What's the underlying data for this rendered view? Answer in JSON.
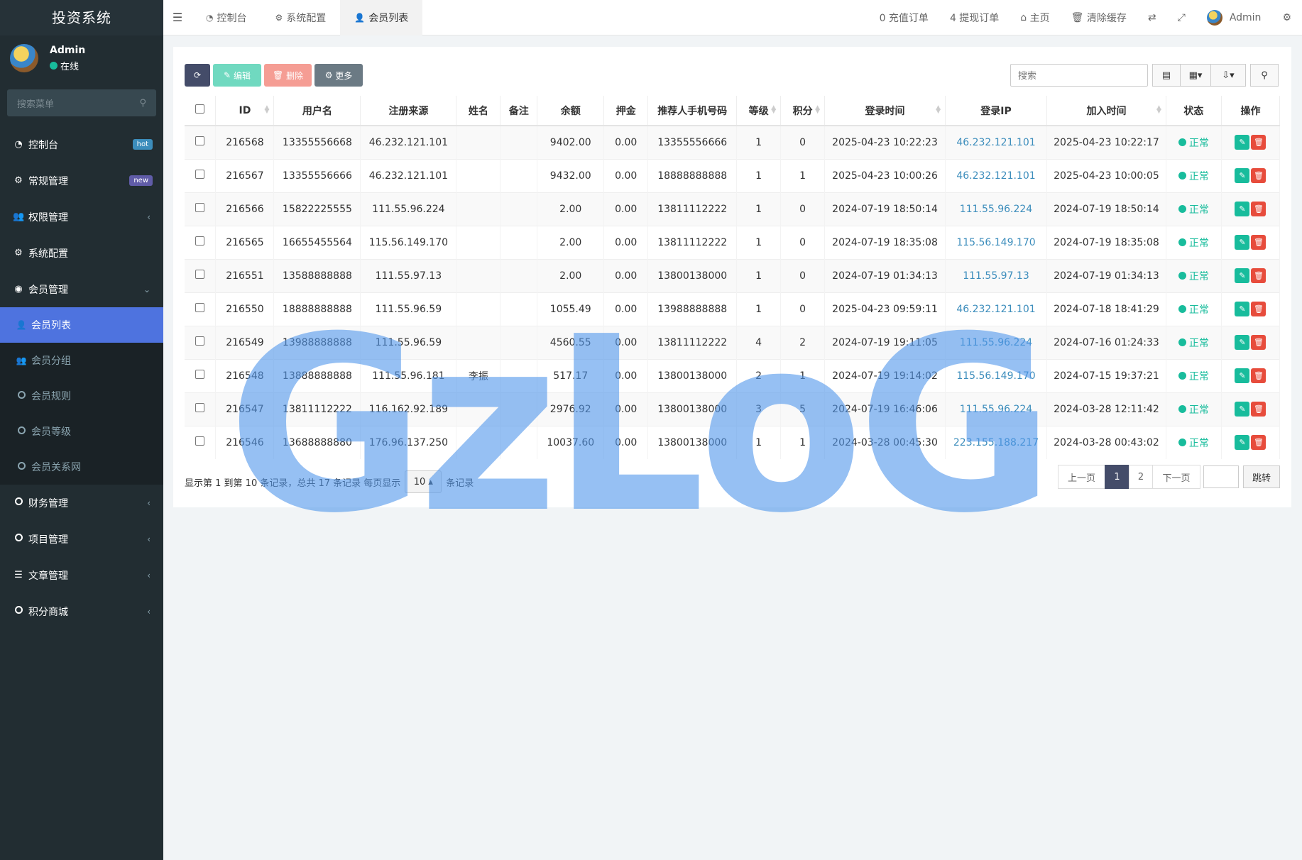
{
  "app": {
    "title": "投资系统"
  },
  "user": {
    "name": "Admin",
    "status": "在线"
  },
  "sidebar": {
    "search_placeholder": "搜索菜单",
    "items": [
      {
        "label": "控制台",
        "badge": "hot"
      },
      {
        "label": "常规管理",
        "badge": "new"
      },
      {
        "label": "权限管理"
      },
      {
        "label": "系统配置"
      },
      {
        "label": "会员管理"
      }
    ],
    "sub": [
      "会员列表",
      "会员分组",
      "会员规则",
      "会员等级",
      "会员关系网"
    ],
    "more": [
      "财务管理",
      "项目管理",
      "文章管理",
      "积分商城"
    ]
  },
  "topbar": {
    "tabs": [
      "控制台",
      "系统配置",
      "会员列表"
    ],
    "recharge": "0 充值订单",
    "withdraw": "4 提现订单",
    "home": "主页",
    "clear_cache": "清除缓存",
    "admin": "Admin"
  },
  "toolbar": {
    "edit": "编辑",
    "delete": "删除",
    "more": "更多",
    "search_placeholder": "搜索"
  },
  "table": {
    "headers": [
      "ID",
      "用户名",
      "注册来源",
      "姓名",
      "备注",
      "余额",
      "押金",
      "推荐人手机号码",
      "等级",
      "积分",
      "登录时间",
      "登录IP",
      "加入时间",
      "状态",
      "操作"
    ],
    "rows": [
      [
        "216568",
        "13355556668",
        "46.232.121.101",
        "",
        "",
        "9402.00",
        "0.00",
        "13355556666",
        "1",
        "0",
        "2025-04-23 10:22:23",
        "46.232.121.101",
        "2025-04-23 10:22:17",
        "正常"
      ],
      [
        "216567",
        "13355556666",
        "46.232.121.101",
        "",
        "",
        "9432.00",
        "0.00",
        "18888888888",
        "1",
        "1",
        "2025-04-23 10:00:26",
        "46.232.121.101",
        "2025-04-23 10:00:05",
        "正常"
      ],
      [
        "216566",
        "15822225555",
        "111.55.96.224",
        "",
        "",
        "2.00",
        "0.00",
        "13811112222",
        "1",
        "0",
        "2024-07-19 18:50:14",
        "111.55.96.224",
        "2024-07-19 18:50:14",
        "正常"
      ],
      [
        "216565",
        "16655455564",
        "115.56.149.170",
        "",
        "",
        "2.00",
        "0.00",
        "13811112222",
        "1",
        "0",
        "2024-07-19 18:35:08",
        "115.56.149.170",
        "2024-07-19 18:35:08",
        "正常"
      ],
      [
        "216551",
        "13588888888",
        "111.55.97.13",
        "",
        "",
        "2.00",
        "0.00",
        "13800138000",
        "1",
        "0",
        "2024-07-19 01:34:13",
        "111.55.97.13",
        "2024-07-19 01:34:13",
        "正常"
      ],
      [
        "216550",
        "18888888888",
        "111.55.96.59",
        "",
        "",
        "1055.49",
        "0.00",
        "13988888888",
        "1",
        "0",
        "2025-04-23 09:59:11",
        "46.232.121.101",
        "2024-07-18 18:41:29",
        "正常"
      ],
      [
        "216549",
        "13988888888",
        "111.55.96.59",
        "",
        "",
        "4560.55",
        "0.00",
        "13811112222",
        "4",
        "2",
        "2024-07-19 19:11:05",
        "111.55.96.224",
        "2024-07-16 01:24:33",
        "正常"
      ],
      [
        "216548",
        "13888888888",
        "111.55.96.181",
        "李振",
        "",
        "517.17",
        "0.00",
        "13800138000",
        "2",
        "1",
        "2024-07-19 19:14:02",
        "115.56.149.170",
        "2024-07-15 19:37:21",
        "正常"
      ],
      [
        "216547",
        "13811112222",
        "116.162.92.189",
        "",
        "",
        "2976.92",
        "0.00",
        "13800138000",
        "3",
        "5",
        "2024-07-19 16:46:06",
        "111.55.96.224",
        "2024-03-28 12:11:42",
        "正常"
      ],
      [
        "216546",
        "13688888880",
        "176.96.137.250",
        "",
        "",
        "10037.60",
        "0.00",
        "13800138000",
        "1",
        "1",
        "2024-03-28 00:45:30",
        "223.155.188.217",
        "2024-03-28 00:43:02",
        "正常"
      ]
    ]
  },
  "pagination": {
    "info_prefix": "显示第 1 到第 10 条记录，总共 17 条记录 每页显示",
    "page_size": "10",
    "info_suffix": "条记录",
    "prev": "上一页",
    "pages": [
      "1",
      "2"
    ],
    "next": "下一页",
    "jump": "跳转"
  },
  "watermark": "GzLoG",
  "colors": {
    "sidebar": "#222d32",
    "active": "#4e73df",
    "status": "#18bc9c",
    "link": "#3c8dbc"
  }
}
